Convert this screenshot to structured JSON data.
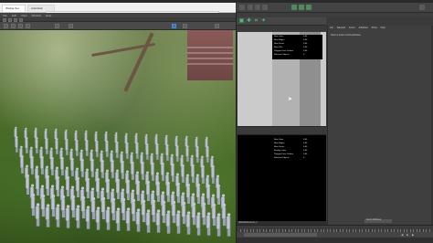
{
  "browser": {
    "tabs": [
      {
        "label": "Wedge Set"
      },
      {
        "label": "Autodesk"
      }
    ]
  },
  "left_app": {
    "menu": [
      "File",
      "Edit",
      "View",
      "Window",
      "Help"
    ],
    "title": "Maya"
  },
  "maya": {
    "right_panel": {
      "menu": [
        "List",
        "Selected",
        "Focus",
        "Attributes",
        "Show",
        "Help"
      ],
      "hint": "Select a node to show attributes."
    },
    "hud_top": [
      {
        "label": "Num Verts",
        "value": "0.00"
      },
      {
        "label": "Num Edges",
        "value": "0.00"
      },
      {
        "label": "Num Faces",
        "value": "0.00"
      },
      {
        "label": "Num UVs",
        "value": "0.00"
      },
      {
        "label": "Polygon Face Outline",
        "value": "0.00"
      },
      {
        "label": "Selected Objects",
        "value": "0"
      }
    ],
    "hud_bottom": [
      {
        "label": "Num Verts",
        "value": "0.00"
      },
      {
        "label": "Num Edges",
        "value": "0.00"
      },
      {
        "label": "Num Faces",
        "value": "0.00"
      },
      {
        "label": "Display Layer",
        "value": "0.00"
      },
      {
        "label": "Polygon Face Outline",
        "value": "0.00"
      },
      {
        "label": "Selected Objects",
        "value": "0"
      }
    ],
    "status_left": "SplineRefinement_1",
    "status_right": "Zoom Attributes",
    "colors": {
      "accent": "#48c27a",
      "selection": "#3b6fbf"
    }
  }
}
